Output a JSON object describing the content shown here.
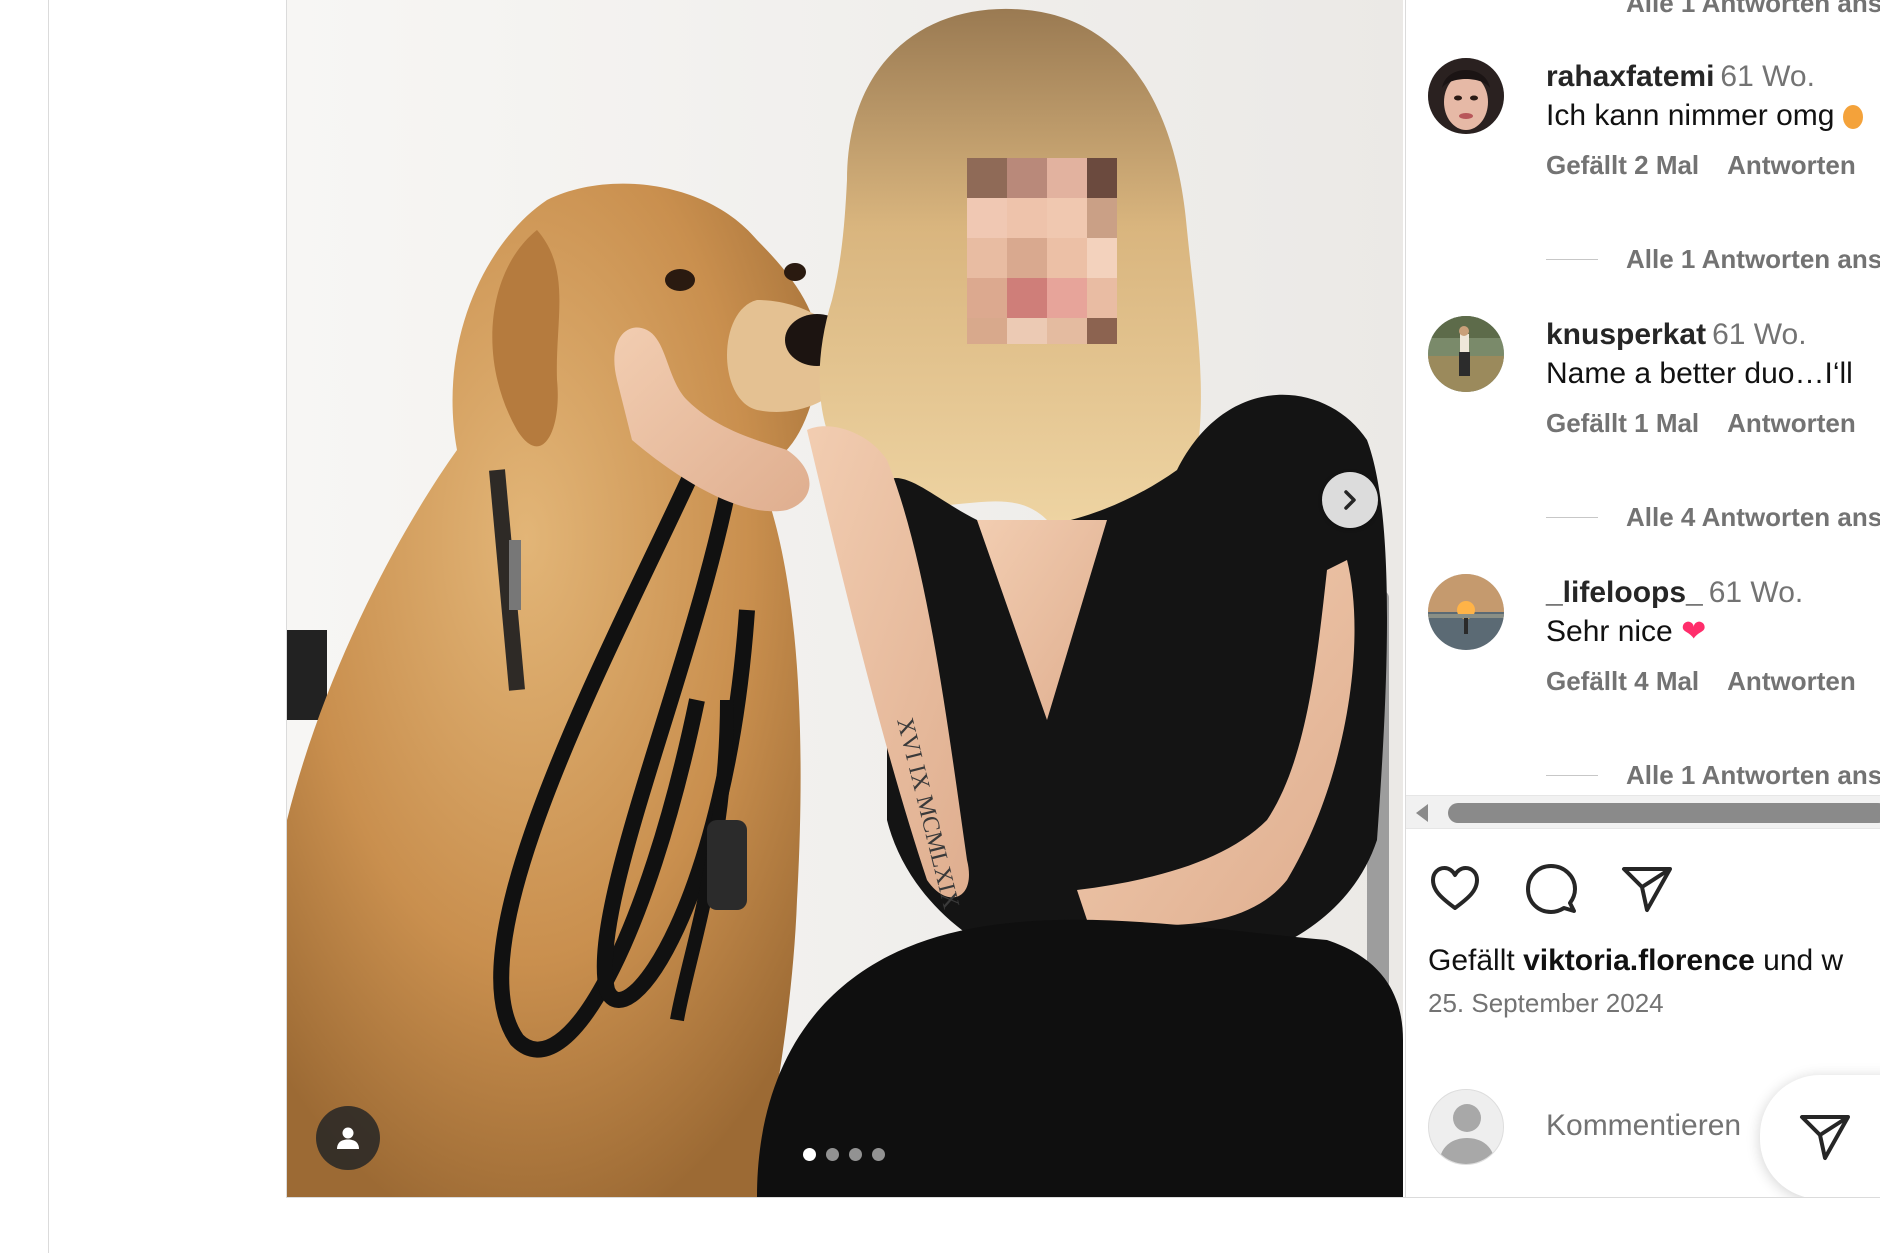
{
  "carousel": {
    "total_slides": 4,
    "active_slide": 1,
    "next_icon": "chevron-right-icon",
    "tag_icon": "user-tag-icon"
  },
  "comments": {
    "top_replies_link": "Alle 1 Antworten ans",
    "items": [
      {
        "username": "rahaxfatemi",
        "time": "61 Wo.",
        "text": "Ich kann nimmer omg",
        "emoji": "",
        "likes": "Gefällt 2 Mal",
        "reply": "Antworten",
        "replies_link": "Alle 1 Antworten ans"
      },
      {
        "username": "knusperkat",
        "time": "61 Wo.",
        "text": "Name a better duo…I‘ll",
        "emoji": "",
        "likes": "Gefällt 1 Mal",
        "reply": "Antworten",
        "replies_link": "Alle 4 Antworten ans"
      },
      {
        "username": "_lifeloops_",
        "time": "61 Wo.",
        "text": "Sehr nice",
        "emoji": "❤",
        "likes": "Gefällt 4 Mal",
        "reply": "Antworten",
        "replies_link": "Alle 1 Antworten ans"
      }
    ]
  },
  "actions": {
    "like_icon": "heart-icon",
    "comment_icon": "comment-icon",
    "share_icon": "paper-plane-icon"
  },
  "post_info": {
    "likes_prefix": "Gefällt",
    "likes_user": "viktoria.florence",
    "likes_suffix": "und w",
    "date": "25. September 2024"
  },
  "comment_input": {
    "placeholder": "Kommentieren",
    "send_icon": "paper-plane-icon"
  },
  "colors": {
    "muted_text": "#737373",
    "border": "#dbdbdb",
    "heart_emoji": "#ff2d6b"
  }
}
